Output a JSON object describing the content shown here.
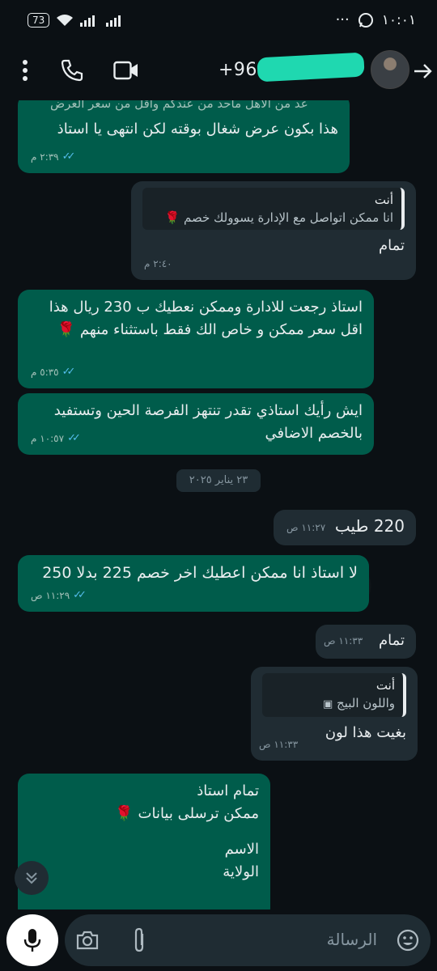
{
  "status_bar": {
    "battery": "73",
    "time": "١٠:٠١",
    "dots": "···"
  },
  "header": {
    "phone_prefix": "+968"
  },
  "messages": [
    {
      "dir": "out",
      "quote_overflow": "عد من الأهل ماحد من عندكم وأقل من سعر العرض",
      "text": "هذا بكون عرض شغال بوقته لكن انتهى يا استاذ",
      "time": "٢:٣٩ م",
      "ticks": "✓✓"
    },
    {
      "dir": "in",
      "quote_name": "أنت",
      "quote_text": "انا ممكن اتواصل مع الإدارة يسوولك خصم 🌹",
      "text": "تمام",
      "time": "٢:٤٠ م"
    },
    {
      "dir": "out",
      "text": "استاذ رجعت للادارة وممكن نعطيك ب 230 ريال هذا اقل سعر ممكن و خاص الك فقط باستثناء منهم 🌹",
      "time": "٥:٣٥ م",
      "ticks": "✓✓"
    },
    {
      "dir": "out",
      "text": "ايش رأيك استاذي تقدر تنتهز الفرصة الحين وتستفيد بالخصم الاضافي",
      "time": "١٠:٥٧ م",
      "ticks": "✓✓"
    },
    {
      "dir": "in",
      "text": "220 طيب",
      "time": "١١:٢٧ ص"
    },
    {
      "dir": "out",
      "text": "لا استاذ انا ممكن اعطيك اخر خصم 225 بدلا 250",
      "time": "١١:٢٩ ص",
      "ticks": "✓✓"
    },
    {
      "dir": "in",
      "text": "تمام",
      "time": "١١:٣٣ ص"
    },
    {
      "dir": "in",
      "quote_name": "أنت",
      "quote_text": "واللون البيج",
      "text": "بغيت هذا لون",
      "time": "١١:٣٣ ص"
    },
    {
      "dir": "out",
      "text_lines": [
        "تمام استاذ",
        "ممكن ترسلى بيانات 🌹",
        "",
        "الاسم",
        "الولاية"
      ]
    }
  ],
  "date_chip": "٢٣ يناير ٢٠٢٥",
  "composer": {
    "placeholder": "الرسالة"
  },
  "colors": {
    "outgoing_bubble": "#005c4b",
    "incoming_bubble": "#202c33",
    "background": "#0b1014",
    "read_ticks": "#53bdeb",
    "redaction_highlight": "#1fd8b0"
  }
}
